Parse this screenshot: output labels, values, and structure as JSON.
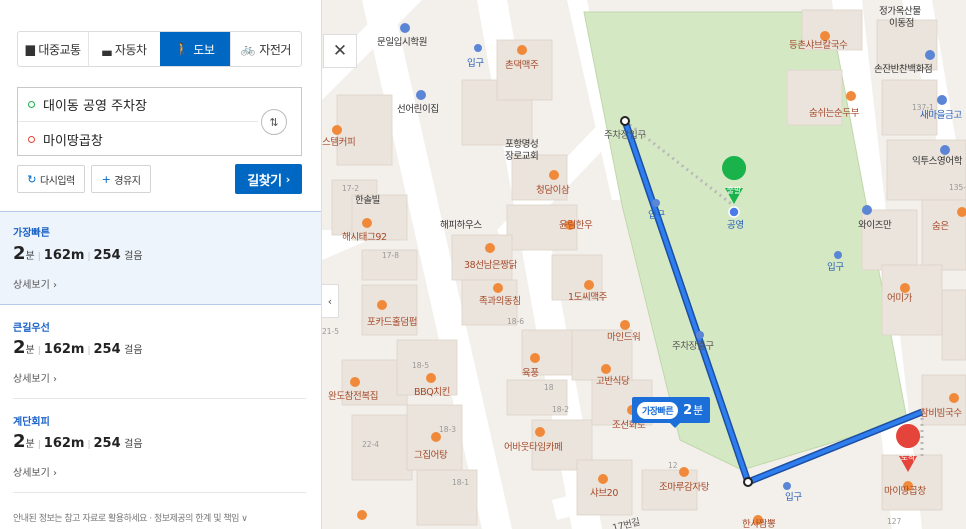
{
  "modes": [
    {
      "label": "대중교통",
      "icon": "bus-icon",
      "glyph": "▆"
    },
    {
      "label": "자동차",
      "icon": "car-icon",
      "glyph": "▃"
    },
    {
      "label": "도보",
      "icon": "walk-icon",
      "glyph": "🚶"
    },
    {
      "label": "자전거",
      "icon": "bike-icon",
      "glyph": "🚲"
    }
  ],
  "active_mode": "도보",
  "origin": "대이동 공영 주차장",
  "destination": "마이땅곱창",
  "buttons": {
    "reset": "다시입력",
    "via": "경유지",
    "search": "길찾기"
  },
  "routes": [
    {
      "label": "가장빠른",
      "minutes": "2",
      "min_unit": "분",
      "distance": "162m",
      "steps": "254",
      "steps_unit": "걸음",
      "detail": "상세보기"
    },
    {
      "label": "큰길우선",
      "minutes": "2",
      "min_unit": "분",
      "distance": "162m",
      "steps": "254",
      "steps_unit": "걸음",
      "detail": "상세보기"
    },
    {
      "label": "계단회피",
      "minutes": "2",
      "min_unit": "분",
      "distance": "162m",
      "steps": "254",
      "steps_unit": "걸음",
      "detail": "상세보기"
    }
  ],
  "disclaimer": "안내된 정보는 참고 자료로 활용하세요 · 정보제공의 한계 및 책임 ∨",
  "map": {
    "route_bubble": {
      "tag": "가장빠른",
      "minutes": "2",
      "unit": "분"
    },
    "start_marker": "출발",
    "end_marker": "도착",
    "labels": {
      "p1": "문일입시학원",
      "p2": "입구",
      "p3": "촌댁맥주",
      "p4": "선어린이집",
      "p5": "스템커피",
      "p6": "포항명성",
      "p6b": "장로교회",
      "p7": "주차장입구",
      "p8": "청담이삼",
      "p9": "한솔빌",
      "p10": "해시태그92",
      "p11": "해피하우스",
      "p12": "윤림한우",
      "p13": "입구",
      "p14": "공영",
      "p15": "38선남은짱닭",
      "p16": "족과의동침",
      "p17": "1도씨맥주",
      "p18": "포카드홀덤펍",
      "p19": "마인드워",
      "p20": "주차장출구",
      "p21": "육풍",
      "p22": "고반식당",
      "p23": "완도참전복집",
      "p24": "BBQ치킨",
      "p25": "조선화로",
      "p26": "그집어탕",
      "p27": "어바웃타임카페",
      "p28": "샤브20",
      "p29": "조마루감자탕",
      "p30": "한사짬뽕",
      "p31": "입구",
      "p32": "마이땅곱창",
      "p33": "정가옥산물",
      "p33b": "이동점",
      "p34": "등촌샤브칼국수",
      "p35": "손잔반찬백화점",
      "p36": "숨쉬는순두부",
      "p37": "새마을금고",
      "p38": "익투스영어학",
      "p39": "와이즈만",
      "p40": "숨은",
      "p41": "입구",
      "p42": "어미가",
      "p43": "참비빔국수",
      "p44": "17번길",
      "p45": "어미가"
    }
  },
  "colors": {
    "accent": "#0068c3",
    "route": "#1c6fd8",
    "park": "#d5e8c4",
    "start": "#19b24b",
    "end": "#e5443a"
  }
}
